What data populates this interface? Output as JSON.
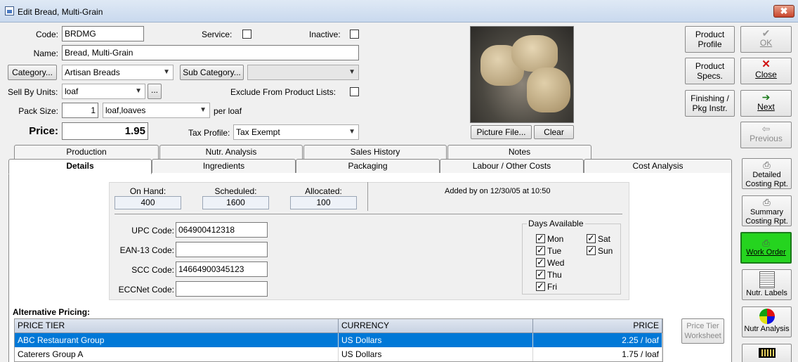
{
  "window": {
    "title": "Edit Bread, Multi-Grain",
    "close": "✖"
  },
  "form": {
    "code_label": "Code:",
    "code": "BRDMG",
    "service_label": "Service:",
    "inactive_label": "Inactive:",
    "name_label": "Name:",
    "name": "Bread, Multi-Grain",
    "category_button": "Category...",
    "category": "Artisan Breads",
    "subcategory_button": "Sub Category...",
    "subcategory": "",
    "sell_by_label": "Sell By Units:",
    "sell_by": "loaf",
    "ellipsis": "...",
    "exclude_label": "Exclude From Product Lists:",
    "pack_size_label": "Pack Size:",
    "pack_size": "1",
    "pack_unit": "loaf,loaves",
    "per_unit": "per loaf",
    "price_label": "Price:",
    "price": "1.95",
    "tax_label": "Tax Profile:",
    "tax": "Tax Exempt"
  },
  "picture": {
    "file_button": "Picture File...",
    "clear_button": "Clear"
  },
  "side": {
    "product_profile": "Product Profile",
    "ok": "OK",
    "product_specs": "Product Specs.",
    "close": "Close",
    "finishing": "Finishing / Pkg Instr.",
    "next": "Next",
    "previous": "Previous",
    "detailed": "Detailed Costing Rpt.",
    "summary": "Summary Costing Rpt.",
    "work_order": "Work Order",
    "nutr_labels": "Nutr. Labels",
    "nutr_analysis": "Nutr Analysis"
  },
  "tabs_back": [
    "Production",
    "Nutr. Analysis",
    "Sales History",
    "Notes"
  ],
  "tabs_front": [
    "Details",
    "Ingredients",
    "Packaging",
    "Labour / Other Costs",
    "Cost Analysis"
  ],
  "details": {
    "on_hand_label": "On Hand:",
    "on_hand": "400",
    "scheduled_label": "Scheduled:",
    "scheduled": "1600",
    "allocated_label": "Allocated:",
    "allocated": "100",
    "added_by": "Added by  on 12/30/05 at 10:50",
    "upc_label": "UPC Code:",
    "upc": "064900412318",
    "ean_label": "EAN-13 Code:",
    "ean": "",
    "scc_label": "SCC Code:",
    "scc": "14664900345123",
    "eccnet_label": "ECCNet Code:",
    "eccnet": ""
  },
  "days": {
    "title": "Days Available",
    "items": [
      {
        "label": "Mon",
        "checked": true
      },
      {
        "label": "Tue",
        "checked": true
      },
      {
        "label": "Wed",
        "checked": true
      },
      {
        "label": "Thu",
        "checked": true
      },
      {
        "label": "Fri",
        "checked": true
      },
      {
        "label": "Sat",
        "checked": true
      },
      {
        "label": "Sun",
        "checked": true
      }
    ]
  },
  "alt_pricing": {
    "title": "Alternative Pricing:",
    "columns": [
      "PRICE TIER",
      "CURRENCY",
      "PRICE"
    ],
    "rows": [
      {
        "tier": "ABC Restaurant Group",
        "currency": "US Dollars",
        "price": "2.25 / loaf"
      },
      {
        "tier": "Caterers Group A",
        "currency": "US Dollars",
        "price": "1.75 / loaf"
      }
    ],
    "worksheet_button": "Price Tier Worksheet"
  }
}
